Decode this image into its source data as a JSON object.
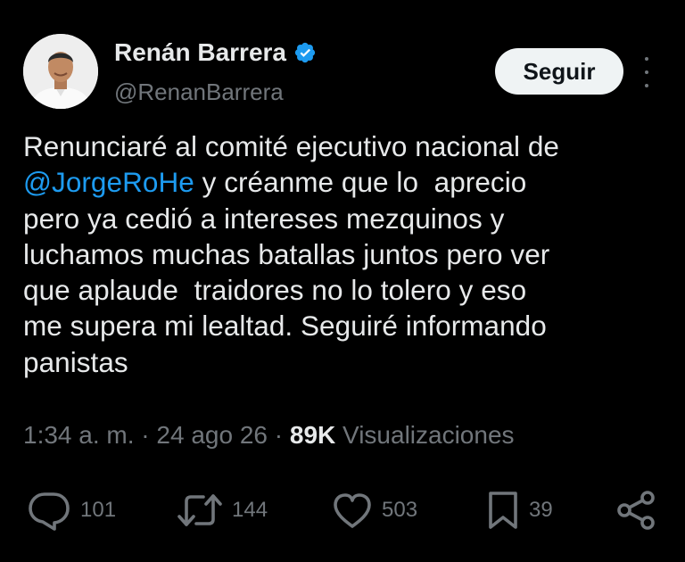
{
  "author": {
    "name": "Renán Barrera",
    "handle": "@RenanBarrera",
    "verified": true,
    "verified_color": "#1d9bf0"
  },
  "header": {
    "follow_label": "Seguir",
    "more_icon": "more-vertical-icon"
  },
  "tweet": {
    "lines": [
      {
        "parts": [
          {
            "text": "Renunciaré al comité ejecutivo nacional de",
            "type": "text"
          }
        ]
      },
      {
        "parts": [
          {
            "text": "@JorgeRoHe",
            "type": "mention"
          },
          {
            "text": " y créanme que lo  aprecio",
            "type": "text"
          }
        ]
      },
      {
        "parts": [
          {
            "text": "pero ya cedió a intereses mezquinos y",
            "type": "text"
          }
        ]
      },
      {
        "parts": [
          {
            "text": "luchamos muchas batallas juntos pero ver",
            "type": "text"
          }
        ]
      },
      {
        "parts": [
          {
            "text": "que aplaude  traidores no lo tolero y eso",
            "type": "text"
          }
        ]
      },
      {
        "parts": [
          {
            "text": "me supera mi lealtad. Seguiré informando",
            "type": "text"
          }
        ]
      },
      {
        "parts": [
          {
            "text": "panistas",
            "type": "text"
          }
        ]
      }
    ],
    "mention_color": "#1d9bf0"
  },
  "meta": {
    "time": "1:34 a. m.",
    "date": "24 ago 26",
    "separator": "·",
    "views_count": "89K",
    "views_label": "Visualizaciones"
  },
  "actions": {
    "replies": {
      "icon": "reply-icon",
      "count": "101"
    },
    "reposts": {
      "icon": "repost-icon",
      "count": "144"
    },
    "likes": {
      "icon": "heart-icon",
      "count": "503"
    },
    "bookmarks": {
      "icon": "bookmark-icon",
      "count": "39"
    },
    "share": {
      "icon": "share-icon"
    }
  }
}
